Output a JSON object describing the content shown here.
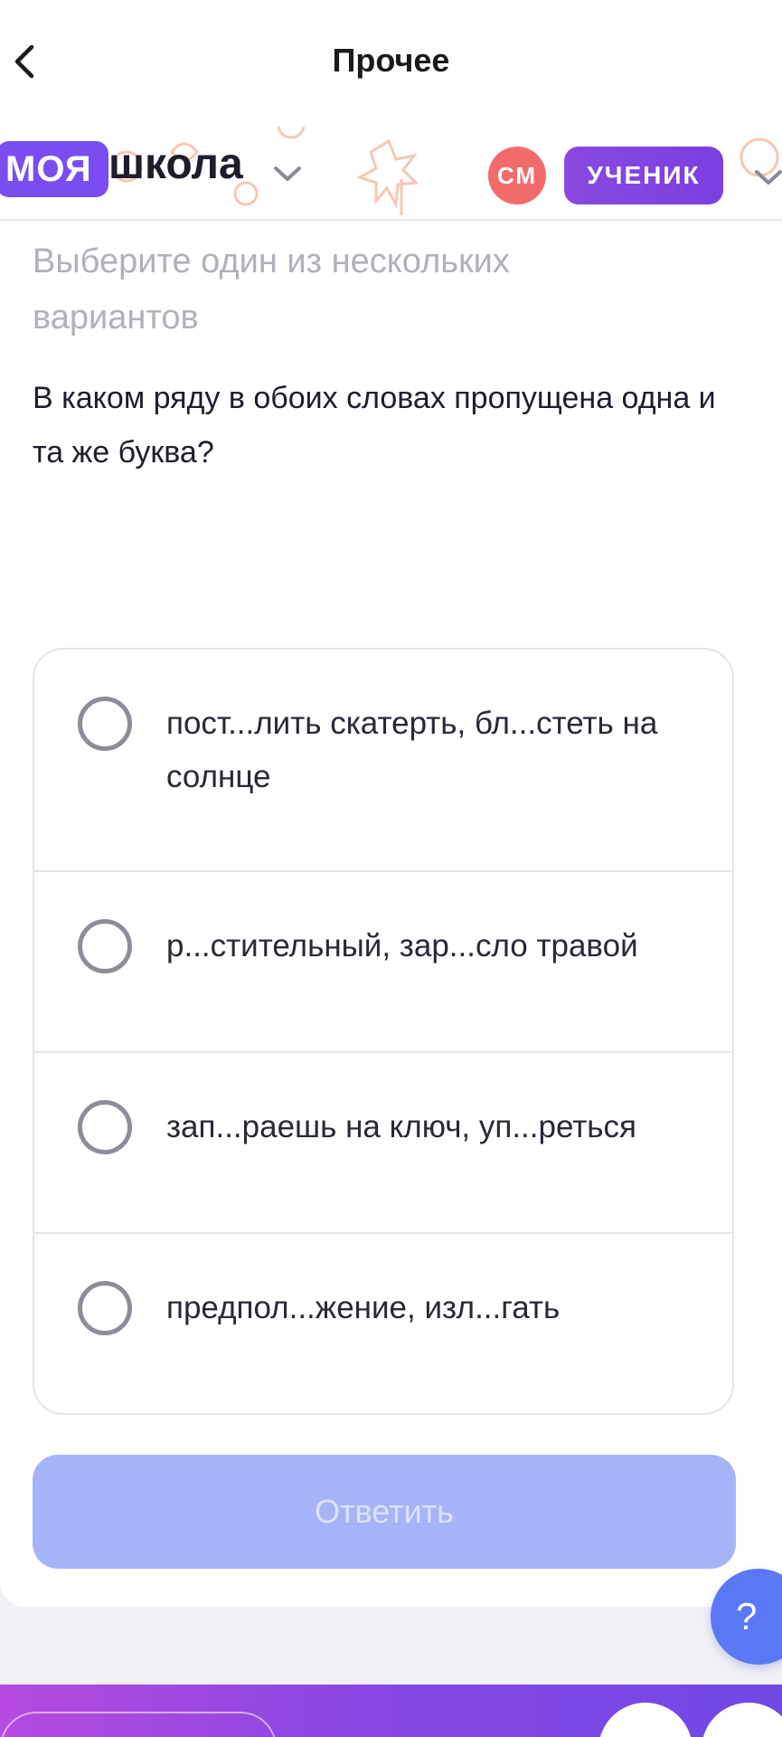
{
  "nav": {
    "title": "Прочее",
    "back_icon": "chevron-left-icon"
  },
  "brand": {
    "logo_part1": "МОЯ",
    "logo_part2": "школа",
    "avatar_initials": "СМ",
    "role": "УЧЕНИК",
    "colors": {
      "logo": "#7a4df0",
      "avatar": "#f26b6b",
      "role": "#8a48e0"
    }
  },
  "task": {
    "hint": "Выберите один из нескольких вариантов",
    "question": "В каком ряду в обоих словах пропущена одна и та же буква?",
    "options": [
      {
        "text": "пост...лить скатерть, бл...стеть на солнце",
        "selected": false
      },
      {
        "text": "р...стительный, зар...сло травой",
        "selected": false
      },
      {
        "text": "зап...раешь на ключ, уп...реться",
        "selected": false
      },
      {
        "text": "предпол...жение, изл...гать",
        "selected": false
      }
    ],
    "submit_label": "Ответить",
    "submit_color": "#a5b4f6"
  },
  "help": {
    "label": "?"
  }
}
